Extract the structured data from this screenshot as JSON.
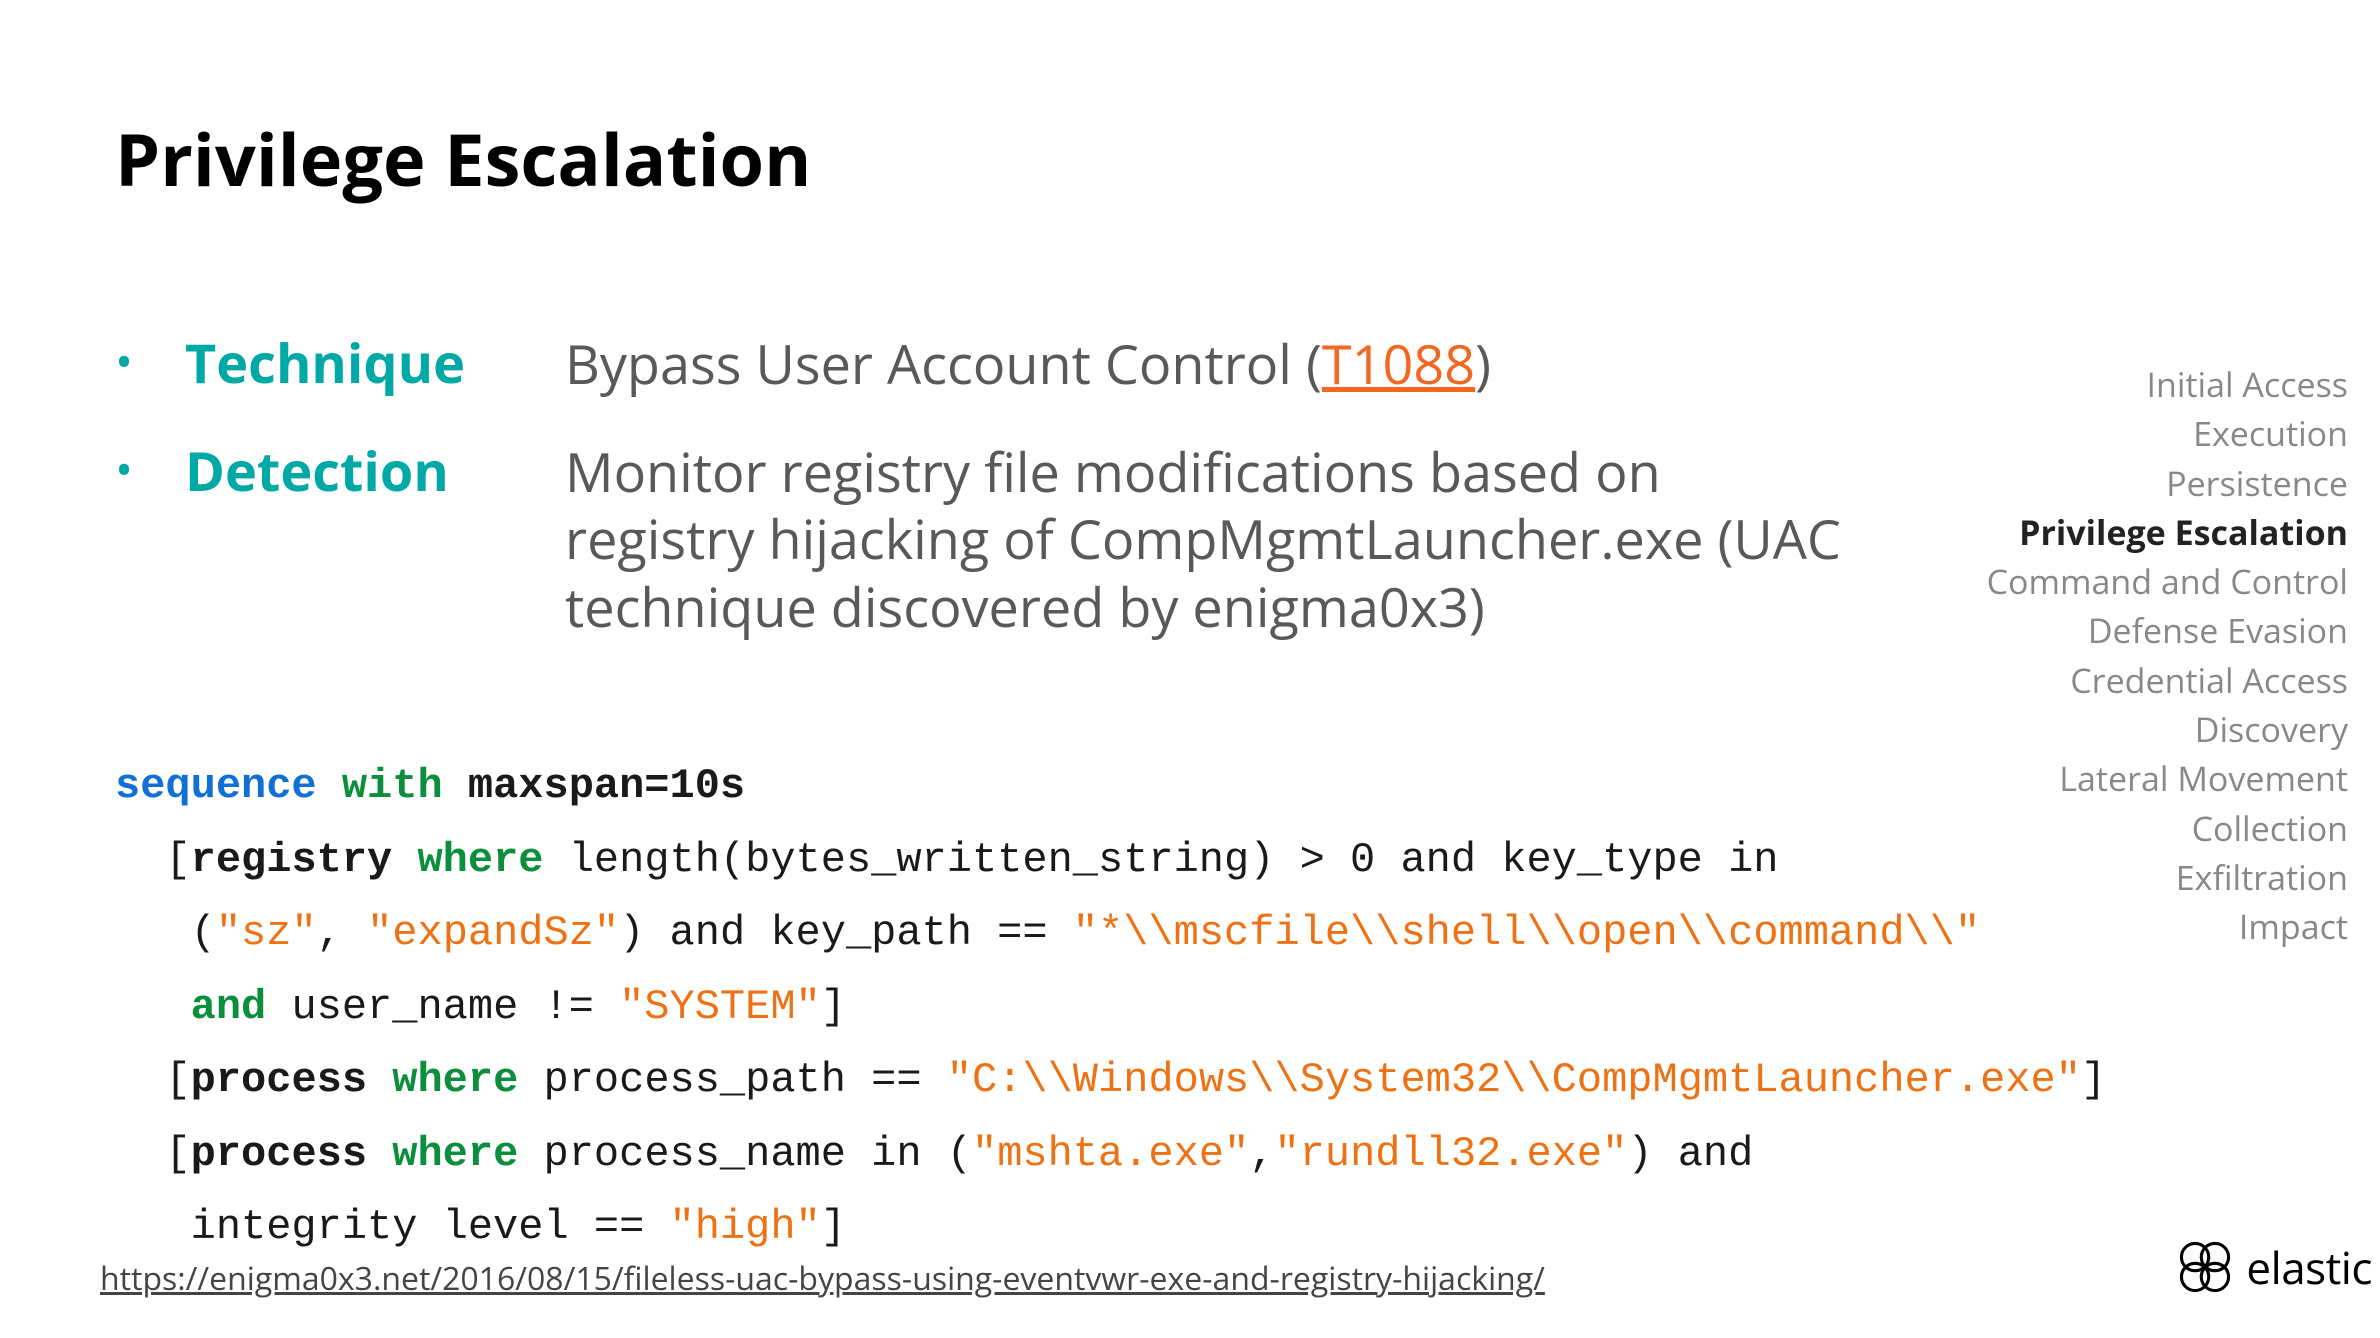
{
  "title": "Privilege Escalation",
  "rows": {
    "technique_label": "Technique",
    "technique_prefix": "Bypass User Account Control (",
    "technique_link": "T1088",
    "technique_suffix": ")",
    "detection_label": "Detection",
    "detection_value": "Monitor registry file modifications based on registry hijacking of CompMgmtLauncher.exe (UAC technique discovered by enigma0x3)"
  },
  "sidebar": [
    "Initial Access",
    "Execution",
    "Persistence",
    "Privilege Escalation",
    "Command and Control",
    "Defense Evasion",
    "Credential Access",
    "Discovery",
    "Lateral Movement",
    "Collection",
    "Exfiltration",
    "Impact"
  ],
  "sidebar_active_index": 3,
  "code": {
    "l1_a": "sequence",
    "l1_b": " with ",
    "l1_c": "maxspan=10s",
    "l2_a": "  [",
    "l2_b": "registry",
    "l2_c": " where",
    "l2_d": " length(bytes_written_string) > 0 and key_type in",
    "l3_a": "   (",
    "l3_b": "\"sz\"",
    "l3_c": ", ",
    "l3_d": "\"expandSz\"",
    "l3_e": ") and key_path == ",
    "l3_f": "\"*\\\\mscfile\\\\shell\\\\open\\\\command\\\\\"",
    "l4_a": "   and",
    "l4_b": " user_name != ",
    "l4_c": "\"SYSTEM\"",
    "l4_d": "]",
    "l5_a": "  [",
    "l5_b": "process",
    "l5_c": " where",
    "l5_d": " process_path == ",
    "l5_e": "\"C:\\\\Windows\\\\System32\\\\CompMgmtLauncher.exe\"",
    "l5_f": "]",
    "l6_a": "  [",
    "l6_b": "process",
    "l6_c": " where",
    "l6_d": " process_name in (",
    "l6_e": "\"mshta.exe\"",
    "l6_f": ",",
    "l6_g": "\"rundll32.exe\"",
    "l6_h": ") and",
    "l7_a": "   integrity level == ",
    "l7_b": "\"high\"",
    "l7_c": "]"
  },
  "footer_link": "https://enigma0x3.net/2016/08/15/fileless-uac-bypass-using-eventvwr-exe-and-registry-hijacking/",
  "logo_text": "elastic"
}
